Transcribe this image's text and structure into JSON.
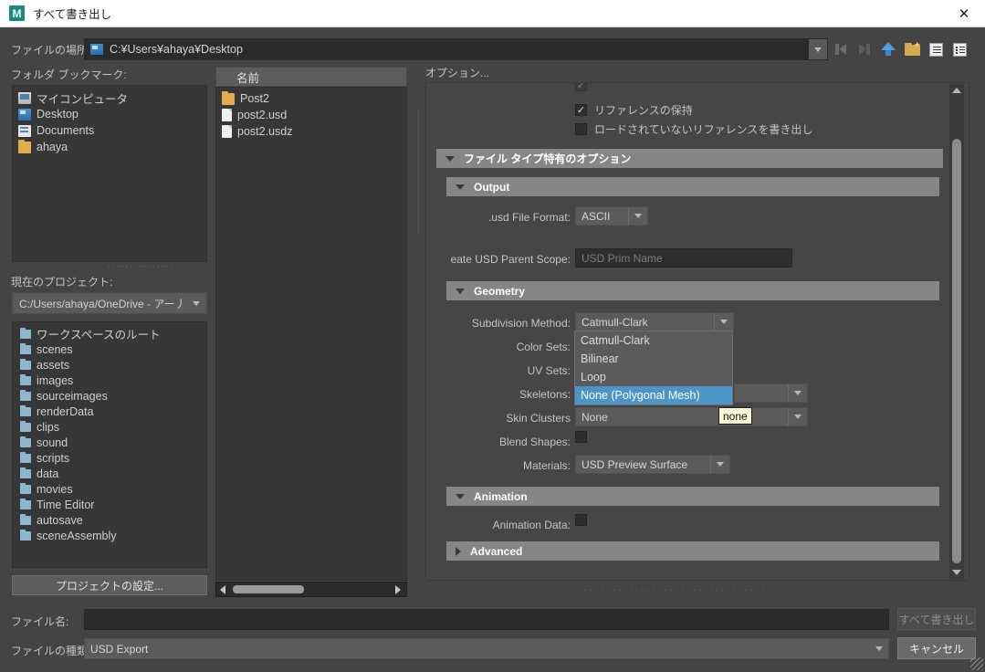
{
  "window": {
    "title": "すべて書き出し",
    "app_icon": "maya-logo-icon",
    "app_icon_letter": "M",
    "close_label": "✕"
  },
  "location": {
    "label": "ファイルの場所:",
    "path": "C:¥Users¥ahaya¥Desktop",
    "dropdown_icon": "chevron-down-icon"
  },
  "toolbar": {
    "items": [
      {
        "icon": "back-arrow-icon",
        "enabled": false
      },
      {
        "icon": "forward-arrow-icon",
        "enabled": false
      },
      {
        "icon": "up-one-level-icon",
        "enabled": true
      },
      {
        "icon": "new-folder-icon",
        "enabled": true
      },
      {
        "icon": "list-view-icon",
        "enabled": true
      },
      {
        "icon": "detail-view-icon",
        "enabled": true
      }
    ]
  },
  "bookmarks": {
    "label": "フォルダ ブックマーク:",
    "items": [
      {
        "label": "マイコンピュータ",
        "icon": "computer-icon"
      },
      {
        "label": "Desktop",
        "icon": "desktop-icon"
      },
      {
        "label": "Documents",
        "icon": "documents-icon"
      },
      {
        "label": "ahaya",
        "icon": "folder-icon"
      }
    ]
  },
  "project": {
    "label": "現在のプロジェクト:",
    "value": "C:/Users/ahaya/OneDrive - アー丿",
    "items": [
      {
        "label": "ワークスペースのルート",
        "icon": "folder-icon"
      },
      {
        "label": "scenes",
        "icon": "folder-icon"
      },
      {
        "label": "assets",
        "icon": "folder-icon"
      },
      {
        "label": "images",
        "icon": "folder-icon"
      },
      {
        "label": "sourceimages",
        "icon": "folder-icon"
      },
      {
        "label": "renderData",
        "icon": "folder-icon"
      },
      {
        "label": "clips",
        "icon": "folder-icon"
      },
      {
        "label": "sound",
        "icon": "folder-icon"
      },
      {
        "label": "scripts",
        "icon": "folder-icon"
      },
      {
        "label": "data",
        "icon": "folder-icon"
      },
      {
        "label": "movies",
        "icon": "folder-icon"
      },
      {
        "label": "Time Editor",
        "icon": "folder-icon"
      },
      {
        "label": "autosave",
        "icon": "folder-icon"
      },
      {
        "label": "sceneAssembly",
        "icon": "folder-icon"
      }
    ],
    "settings_button": "プロジェクトの設定..."
  },
  "filelist": {
    "column_header": "名前",
    "items": [
      {
        "label": "Post2",
        "icon": "folder-icon"
      },
      {
        "label": "post2.usd",
        "icon": "file-icon"
      },
      {
        "label": "post2.usdz",
        "icon": "file-icon"
      }
    ]
  },
  "options": {
    "title": "オプション...",
    "clipped_row_label": "",
    "checkboxes": [
      {
        "label": "リファレンスの保持",
        "checked": true
      },
      {
        "label": "ロードされていないリファレンスを書き出し",
        "checked": false
      }
    ],
    "filetype_section": "ファイル タイプ特有のオプション",
    "sections": [
      {
        "name": "Output",
        "expanded": true
      },
      {
        "name": "Geometry",
        "expanded": true
      },
      {
        "name": "Animation",
        "expanded": true
      },
      {
        "name": "Advanced",
        "expanded": false
      }
    ],
    "usd_file_format": {
      "label": ".usd File Format:",
      "value": "ASCII"
    },
    "parent_scope": {
      "label": "eate USD Parent Scope:",
      "placeholder": "USD Prim Name",
      "value": ""
    },
    "subdivision_method": {
      "label": "Subdivision Method:",
      "value": "Catmull-Clark"
    },
    "color_sets": {
      "label": "Color Sets:"
    },
    "uv_sets": {
      "label": "UV Sets:"
    },
    "skeletons": {
      "label": "Skeletons:",
      "value": ""
    },
    "skin_clusters": {
      "label": "Skin Clusters",
      "value": "None"
    },
    "blend_shapes": {
      "label": "Blend Shapes:",
      "checked": false
    },
    "materials": {
      "label": "Materials:",
      "value": "USD Preview Surface"
    },
    "animation_data": {
      "label": "Animation Data:",
      "checked": false
    }
  },
  "dropdown": {
    "options": [
      {
        "label": "Catmull-Clark",
        "selected": false
      },
      {
        "label": "Bilinear",
        "selected": false
      },
      {
        "label": "Loop",
        "selected": false
      },
      {
        "label": "None (Polygonal Mesh)",
        "selected": true
      }
    ],
    "highlight_color": "#4d94c8"
  },
  "tooltip": {
    "text": "none"
  },
  "bottom": {
    "filename_label": "ファイル名:",
    "filename_value": "",
    "filetype_label": "ファイルの種類:",
    "filetype_value": "USD Export",
    "export_button": "すべて書き出し",
    "export_enabled": false,
    "cancel_button": "キャンセル"
  }
}
